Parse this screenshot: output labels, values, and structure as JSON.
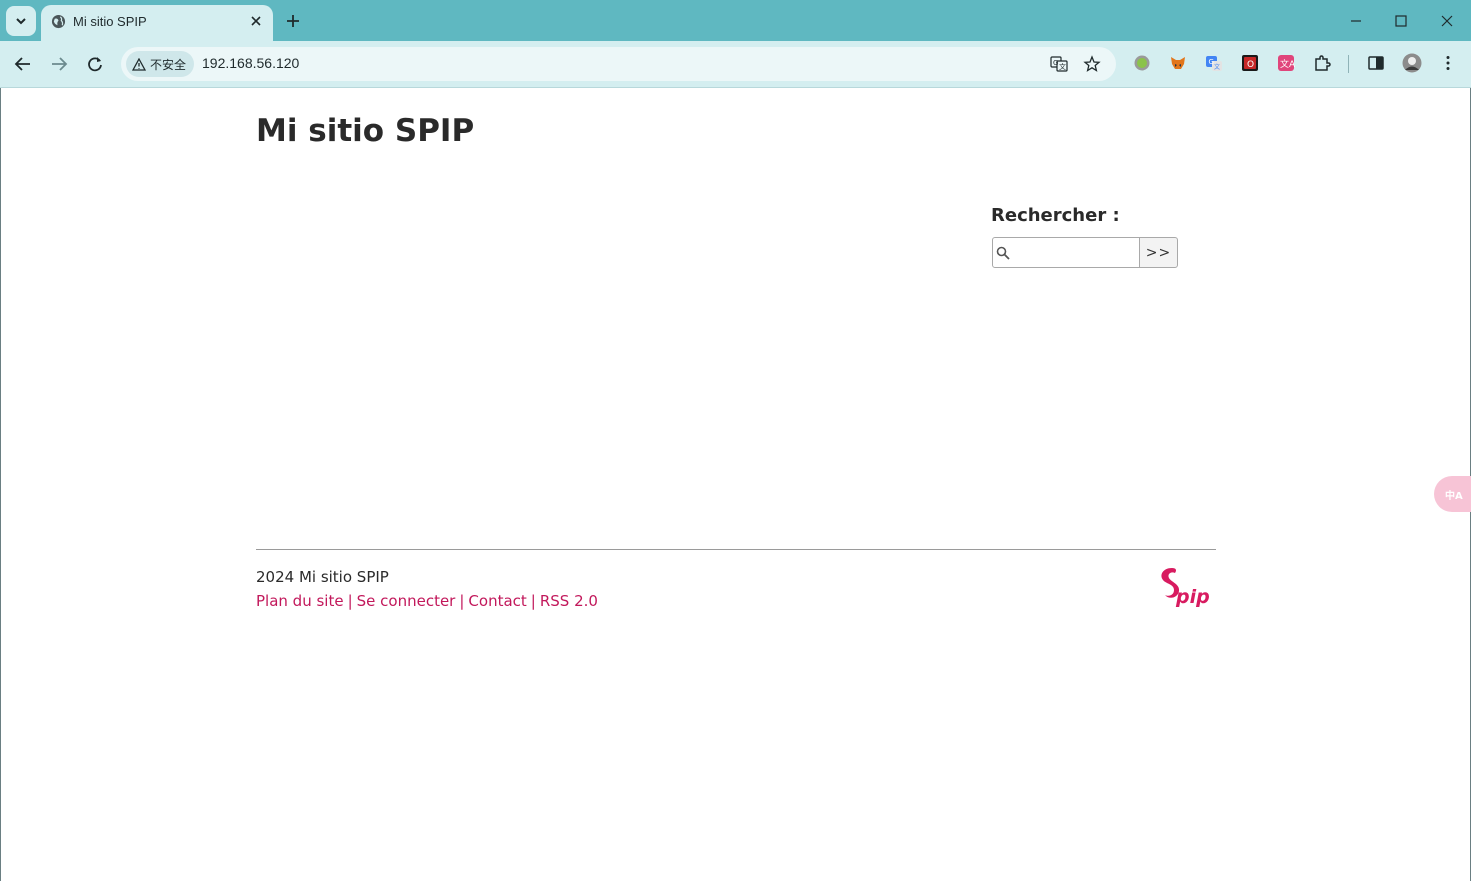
{
  "browser": {
    "tab": {
      "title": "Mi sitio SPIP"
    },
    "security_chip": {
      "label": "不安全"
    },
    "url": "192.168.56.120",
    "extensions": [
      "circle-extension-icon",
      "metamask-icon",
      "google-translate-icon",
      "red-o-extension-icon",
      "pink-translate-extension-icon",
      "puzzle-extensions-icon",
      "side-panel-icon",
      "profile-avatar"
    ]
  },
  "page": {
    "site_title": "Mi sitio SPIP",
    "search": {
      "label": "Rechercher :",
      "input_value": "",
      "submit_label": ">>"
    },
    "footer": {
      "copyright": "2024 Mi sitio SPIP",
      "links": [
        "Plan du site",
        "Se connecter",
        "Contact",
        "RSS 2.0"
      ],
      "separator": "|"
    },
    "colors": {
      "link": "#c2185b",
      "chrome_accent": "#5fb8c1"
    }
  }
}
